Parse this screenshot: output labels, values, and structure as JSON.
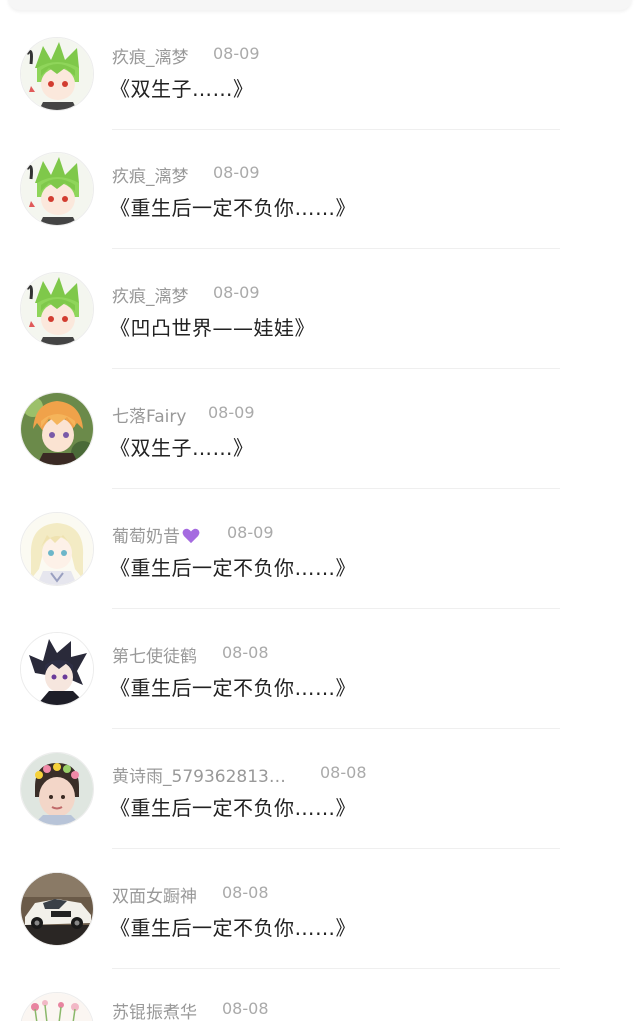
{
  "comments": [
    {
      "user": "疚痕_漓梦",
      "date": "08-09",
      "text": "《双生子……》",
      "avatar": "green-hair-anime-avatar"
    },
    {
      "user": "疚痕_漓梦",
      "date": "08-09",
      "text": "《重生后一定不负你……》",
      "avatar": "green-hair-anime-avatar"
    },
    {
      "user": "疚痕_漓梦",
      "date": "08-09",
      "text": "《凹凸世界——娃娃》",
      "avatar": "green-hair-anime-avatar"
    },
    {
      "user": "七落Fairy",
      "date": "08-09",
      "text": "《双生子……》",
      "avatar": "orange-hair-anime-avatar"
    },
    {
      "user": "葡萄奶昔",
      "date": "08-09",
      "text": "《重生后一定不负你……》",
      "avatar": "blonde-anime-girl-avatar",
      "badge": "purple-heart-icon"
    },
    {
      "user": "第七使徒鹤",
      "date": "08-08",
      "text": "《重生后一定不负你……》",
      "avatar": "dark-hair-anime-avatar"
    },
    {
      "user": "黄诗雨_579362813…",
      "date": "08-08",
      "text": "《重生后一定不负你……》",
      "avatar": "child-flower-crown-avatar"
    },
    {
      "user": "双面女蹰神",
      "date": "08-08",
      "text": "《重生后一定不负你……》",
      "avatar": "race-car-avatar"
    },
    {
      "user": "苏锟振煮华",
      "date": "08-08",
      "text": "",
      "avatar": "flowers-avatar"
    }
  ],
  "colors": {
    "name": "#999999",
    "date": "#aaaaaa",
    "message": "#222222",
    "divider": "#efefef",
    "heart": "#a56be0"
  }
}
